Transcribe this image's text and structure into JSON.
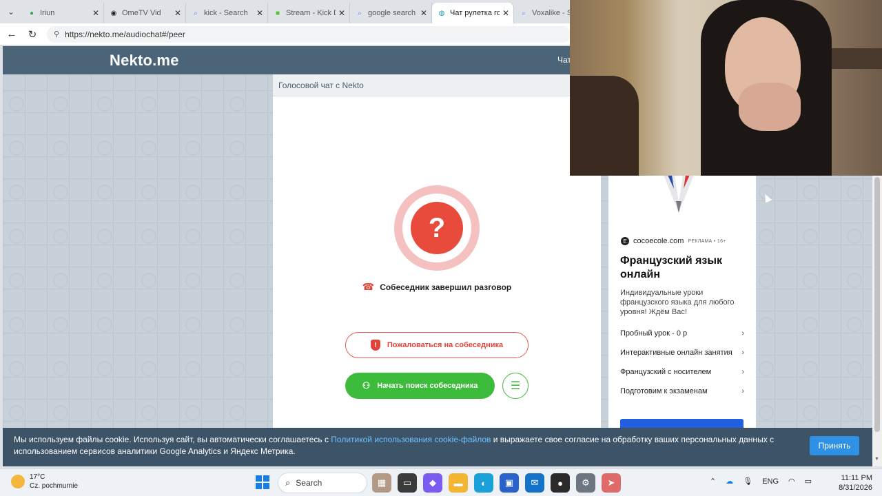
{
  "browser": {
    "tabs": [
      {
        "title": "Iriun",
        "favicon": "green-dot-icon",
        "color": "#34a853"
      },
      {
        "title": "OmeTV Vid",
        "favicon": "record-icon",
        "color": "#222222"
      },
      {
        "title": "kick - Search",
        "favicon": "search-icon",
        "color": "#5b8def"
      },
      {
        "title": "Stream - Kick D",
        "favicon": "kick-icon",
        "color": "#53c529"
      },
      {
        "title": "google search",
        "favicon": "search-icon",
        "color": "#5b8def"
      },
      {
        "title": "Чат рулетка го",
        "favicon": "nekto-icon",
        "color": "#1b9aaa",
        "active": true
      },
      {
        "title": "Voxalike - Se",
        "favicon": "search-icon",
        "color": "#5b8def"
      }
    ],
    "url": "https://nekto.me/audiochat#/peer"
  },
  "site": {
    "logo": "Nekto.me",
    "nav_item": "Чат",
    "chat_header": "Голосовой чат с Nekto",
    "status_text": "Собеседник завершил разговор",
    "question_mark": "?",
    "report_label": "Пожаловаться на собеседника",
    "search_label": "Начать поиск собеседника"
  },
  "ad": {
    "source": "cocoecole.com",
    "source_mark": "РЕКЛАМА • 16+",
    "title": "Французский язык онлайн",
    "description": "Индивидуальные уроки французского языка для любого уровня! Ждём Вас!",
    "items": [
      "Пробный урок - 0 р",
      "Интерактивные онлайн занятия",
      "Французский с носителем",
      "Подготовим к экзаменам"
    ]
  },
  "cookie": {
    "text_before": "Мы используем файлы cookie. Используя сайт, вы автоматически соглашаетесь с ",
    "link": "Политикой использования cookie-файлов",
    "text_after": " и выражаете свое согласие на обработку ваших персональных данных с использованием сервисов аналитики Google Analytics и Яндекс Метрика.",
    "accept": "Принять"
  },
  "taskbar": {
    "temperature": "17°C",
    "weather": "Cz. pochmurnie",
    "search": "Search",
    "language": "ENG",
    "time": "11:11 PM",
    "date": "8/31/2026"
  },
  "colors": {
    "header": "#4c6477",
    "accent_red": "#e0443a",
    "accent_green": "#3dbb3a",
    "cookie_bg": "#3d5367",
    "accept_btn": "#2f91e6"
  }
}
